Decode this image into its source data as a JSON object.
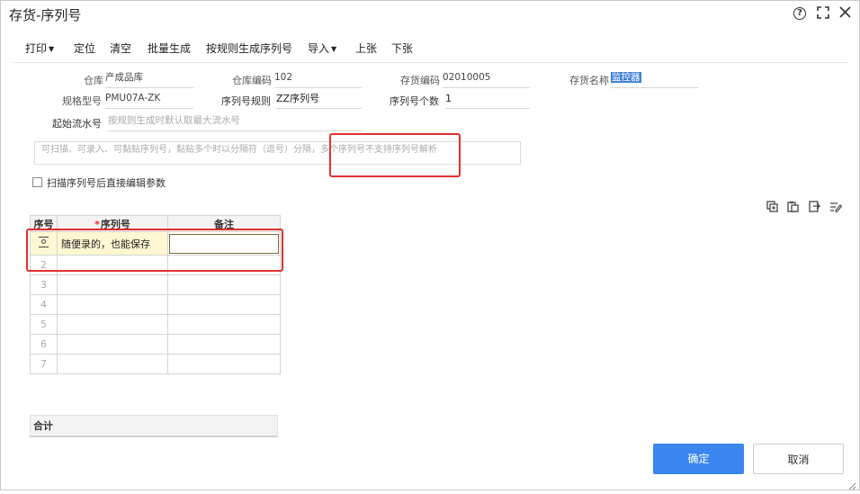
{
  "window": {
    "title": "存货-序列号"
  },
  "toolbar": {
    "print": "打印",
    "locate": "定位",
    "clear": "清空",
    "batch_generate": "批量生成",
    "generate_by_rule": "按规则生成序列号",
    "import": "导入",
    "prev": "上张",
    "next": "下张"
  },
  "form": {
    "warehouse_label": "仓库",
    "warehouse_value": "产成品库",
    "warehouse_code_label": "仓库编码",
    "warehouse_code_value": "102",
    "stock_code_label": "存货编码",
    "stock_code_value": "02010005",
    "stock_name_label": "存货名称",
    "stock_name_value": "监控器",
    "spec_label": "规格型号",
    "spec_value": "PMU07A-ZK",
    "serial_rule_label": "序列号规则",
    "serial_rule_value": "ZZ序列号",
    "serial_count_label": "序列号个数",
    "serial_count_value": "1",
    "start_serial_label": "起始流水号",
    "start_serial_placeholder": "按规则生成时默认取最大流水号"
  },
  "scan_input": {
    "placeholder": "可扫描、可录入、可黏贴序列号，黏贴多个时以分隔符（逗号）分隔，多个序列号不支持序列号解析"
  },
  "edit_after_scan": {
    "label": "扫描序列号后直接编辑参数",
    "checked": false
  },
  "grid": {
    "headers": {
      "index": "序号",
      "serial": "序列号",
      "remark": "备注"
    },
    "required_mark": "*",
    "first_row_serial": "随便录的，也能保存",
    "row_numbers": [
      "2",
      "3",
      "4",
      "5",
      "6",
      "7"
    ]
  },
  "summary": {
    "label": "合计"
  },
  "buttons": {
    "ok": "确定",
    "cancel": "取消"
  },
  "colors": {
    "primary": "#3a86ee",
    "highlight_border": "#e23030",
    "active_row": "#fdf8d2"
  }
}
